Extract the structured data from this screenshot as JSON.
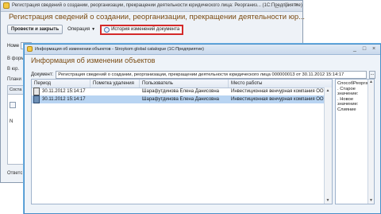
{
  "back_window": {
    "title": "Регистрация сведений о создании, реорганизации, прекращении деятельности юридического лица: Реорганиз... (1С:Предприятие)",
    "controls": [
      "_",
      "□",
      "×"
    ],
    "heading": "Регистрация сведений о создании, реорганизации, прекращении деятельности юр...",
    "toolbar": {
      "post_close_label": "Провести и закрыть",
      "operation_label": "Операция",
      "history_label": "История изменений документа"
    },
    "number_label": "Номе",
    "labels": {
      "form": "В форм",
      "org": "В юр.",
      "planned": "Плани",
      "composition": "Соста",
      "n": "N",
      "response": "Ответс"
    }
  },
  "front_window": {
    "title": "Информация об изменении объектов - Stroykom global catalogue (1С:Предприятие)",
    "controls": [
      "_",
      "□",
      "×"
    ],
    "heading": "Информация об изменении объектов",
    "document_label": "Документ:",
    "document_value": "Регистрация сведений о создании, реорганизации, прекращении деятельности юридического лица 000000013 от 30.11.2012 15:14:17",
    "document_button": "...",
    "table": {
      "columns": [
        "Период",
        "Пометка удаления",
        "Пользователь",
        "Место работы"
      ],
      "rows": [
        {
          "period": "30.11.2012 15:14:17",
          "deletion_mark": "",
          "user": "Шарафутдинова Елена Данисовна",
          "workplace": "Инвестиционная венчурная компания ООО",
          "selected": false
        },
        {
          "period": "30.11.2012 15:14:17",
          "deletion_mark": "",
          "user": "Шарафутдинова Елена Данисовна",
          "workplace": "Инвестиционная венчурная компания ООО",
          "selected": true
        }
      ]
    },
    "side_panel_text": "СпособРеорганизации:\n. Старое значение:\n. Новое значение:\nСлияние"
  },
  "colors": {
    "heading": "#7a4b12",
    "selection": "#b8d4f2",
    "highlight_border": "#d42a2a",
    "front_border": "#4a8fc7"
  },
  "icons": {
    "app": "1c-app-icon",
    "history": "clock-icon",
    "row": "object-icon"
  }
}
